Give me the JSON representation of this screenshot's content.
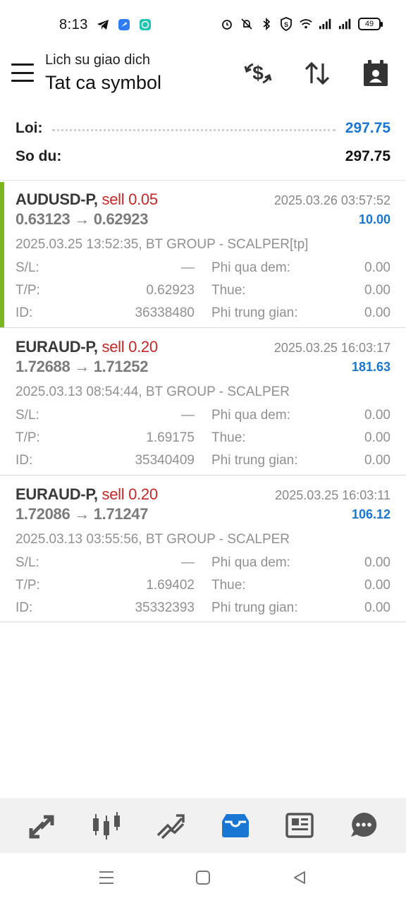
{
  "status_bar": {
    "time": "8:13",
    "battery": "49",
    "left_icons": [
      "telegram-icon",
      "app-icon",
      "messenger-icon"
    ],
    "right_icons": [
      "alarm-icon",
      "mute-icon",
      "bluetooth-icon",
      "vpn-shield-icon",
      "wifi-icon",
      "signal-icon",
      "signal-icon",
      "battery-icon"
    ]
  },
  "header": {
    "subtitle": "Lich su giao dich",
    "title": "Tat ca symbol",
    "icons": [
      "currency-swap-icon",
      "sort-icon",
      "calendar-person-icon"
    ]
  },
  "summary": {
    "profit_label": "Loi:",
    "profit_value": "297.75",
    "balance_label": "So du:",
    "balance_value": "297.75"
  },
  "deals": [
    {
      "symbol": "AUDUSD-P,",
      "side": "sell 0.05",
      "prices": "0.63123 → 0.62923",
      "close_time": "2025.03.26 03:57:52",
      "profit": "10.00",
      "open_info": "2025.03.25 13:52:35, BT GROUP - SCALPER[tp]",
      "sl_label": "S/L:",
      "sl_value": "—",
      "tp_label": "T/P:",
      "tp_value": "0.62923",
      "id_label": "ID:",
      "id_value": "36338480",
      "swap_label": "Phi qua dem:",
      "swap_value": "0.00",
      "tax_label": "Thue:",
      "tax_value": "0.00",
      "commission_label": "Phi trung gian:",
      "commission_value": "0.00",
      "highlighted": true
    },
    {
      "symbol": "EURAUD-P,",
      "side": "sell 0.20",
      "prices": "1.72688 → 1.71252",
      "close_time": "2025.03.25 16:03:17",
      "profit": "181.63",
      "open_info": "2025.03.13 08:54:44, BT GROUP - SCALPER",
      "sl_label": "S/L:",
      "sl_value": "—",
      "tp_label": "T/P:",
      "tp_value": "1.69175",
      "id_label": "ID:",
      "id_value": "35340409",
      "swap_label": "Phi qua dem:",
      "swap_value": "0.00",
      "tax_label": "Thue:",
      "tax_value": "0.00",
      "commission_label": "Phi trung gian:",
      "commission_value": "0.00",
      "highlighted": false
    },
    {
      "symbol": "EURAUD-P,",
      "side": "sell 0.20",
      "prices": "1.72086 → 1.71247",
      "close_time": "2025.03.25 16:03:11",
      "profit": "106.12",
      "open_info": "2025.03.13 03:55:56, BT GROUP - SCALPER",
      "sl_label": "S/L:",
      "sl_value": "—",
      "tp_label": "T/P:",
      "tp_value": "1.69402",
      "id_label": "ID:",
      "id_value": "35332393",
      "swap_label": "Phi qua dem:",
      "swap_value": "0.00",
      "tax_label": "Thue:",
      "tax_value": "0.00",
      "commission_label": "Phi trung gian:",
      "commission_value": "0.00",
      "highlighted": false
    }
  ],
  "bottom_nav": {
    "items": [
      "quotes-icon",
      "chart-icon",
      "trade-icon",
      "history-icon",
      "news-icon",
      "chat-icon"
    ],
    "active": "history-icon",
    "active_color": "#1976d2"
  },
  "colors": {
    "profit_blue": "#1976d2",
    "sell_red": "#c62828",
    "accent_green": "#7cb51d"
  }
}
